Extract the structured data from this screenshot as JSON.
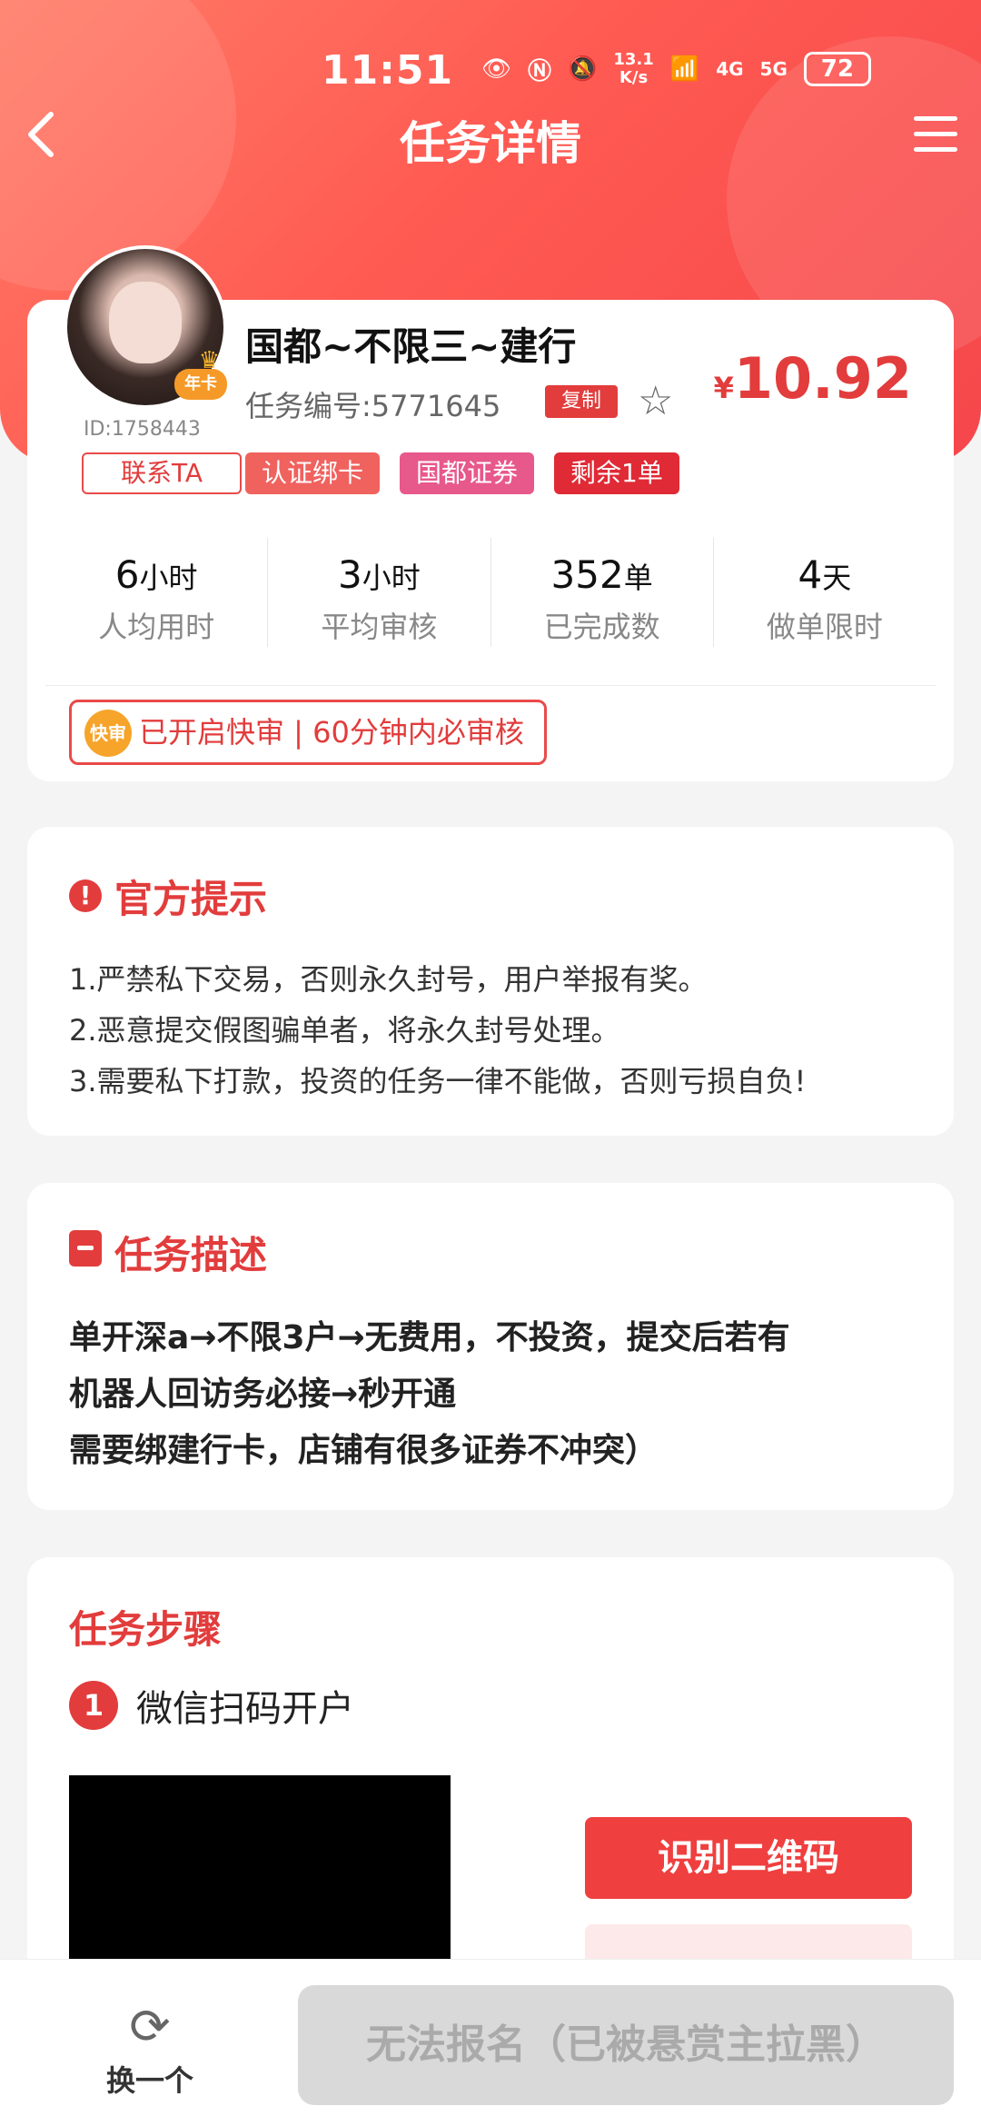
{
  "status_bar": {
    "time": "11:51",
    "net_speed_top": "13.1",
    "net_speed_bottom": "K/s",
    "sig1": "4G",
    "sig2": "5G",
    "battery": "72"
  },
  "nav": {
    "back_icon": "chevron-left-icon",
    "title": "任务详情",
    "menu_icon": "menu-icon"
  },
  "task": {
    "title": "国都~不限三~建行",
    "task_no": "任务编号:5771645",
    "copy_label": "复制",
    "price_currency": "¥",
    "price": "10.92",
    "user_id": "ID:1758443",
    "year_badge": "年卡",
    "contact_label": "联系TA",
    "tags": [
      "认证绑卡",
      "国都证券",
      "剩余1单"
    ]
  },
  "stats": [
    {
      "value": "6",
      "unit": "小时",
      "label": "人均用时"
    },
    {
      "value": "3",
      "unit": "小时",
      "label": "平均审核"
    },
    {
      "value": "352",
      "unit": "单",
      "label": "已完成数"
    },
    {
      "value": "4",
      "unit": "天",
      "label": "做单限时"
    }
  ],
  "fast_review": {
    "icon_label": "快审",
    "text": "已开启快审 | 60分钟内必审核"
  },
  "notice": {
    "title": "官方提示",
    "lines": [
      "1.严禁私下交易，否则永久封号，用户举报有奖。",
      "2.恶意提交假图骗单者，将永久封号处理。",
      "3.需要私下打款，投资的任务一律不能做，否则亏损自负!"
    ]
  },
  "description": {
    "title": "任务描述",
    "lines": [
      "单开深a→不限3户→无费用，不投资，提交后若有",
      "机器人回访务必接→秒开通",
      "需要绑建行卡，店铺有很多证券不冲突）"
    ]
  },
  "steps": {
    "title": "任务步骤",
    "step1_num": "1",
    "step1_text": "微信扫码开户",
    "qr_button": "识别二维码"
  },
  "bottom": {
    "swap_label": "换一个",
    "signup_label": "无法报名（已被悬赏主拉黑）"
  },
  "colors": {
    "accent": "#e23c3c",
    "header_start": "#ff7b66",
    "header_end": "#f5474c"
  }
}
